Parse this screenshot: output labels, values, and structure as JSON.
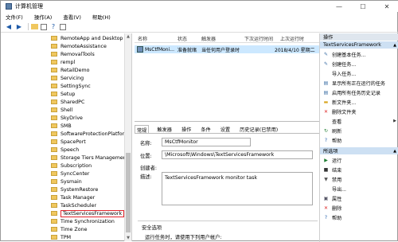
{
  "window": {
    "title": "计算机管理",
    "controls": [
      "—",
      "☐",
      "✕"
    ]
  },
  "menu": [
    "文件(F)",
    "操作(A)",
    "查看(V)",
    "帮助(H)"
  ],
  "tree": {
    "items": [
      "RemoteApp and Desktop C",
      "RemoteAssistance",
      "RemovalTools",
      "rempl",
      "RetailDemo",
      "Servicing",
      "SettingSync",
      "Setup",
      "SharedPC",
      "Shell",
      "SkyDrive",
      "SMB",
      "SoftwareProtectionPlatform",
      "SpacePort",
      "Speech",
      "Storage Tiers Management",
      "Subscription",
      "SyncCenter",
      "Sysmain",
      "SystemRestore",
      "Task Manager",
      "TaskScheduler",
      "TextServicesFramework",
      "Time Synchronization",
      "Time Zone",
      "TPM"
    ],
    "selected_index": 22
  },
  "list": {
    "headers": [
      "名称",
      "状态",
      "触发器",
      "下次运行时间",
      "上次运行时"
    ],
    "row": {
      "name": "MsCtfMoni...",
      "status": "准备就绪",
      "trigger": "当任何用户登录时",
      "next": "",
      "last": "2018/4/10 星期二"
    }
  },
  "detail": {
    "tabs": [
      "常规",
      "触发器",
      "操作",
      "条件",
      "设置",
      "历史记录(已禁用)"
    ],
    "name_label": "名称:",
    "name_value": "MsCtfMonitor",
    "location_label": "位置:",
    "location_value": "\\Microsoft\\Windows\\TextServicesFramework",
    "author_label": "创建者:",
    "desc_label": "描述:",
    "desc_value": "TextServicesFramework monitor task",
    "security_title": "安全选项",
    "security_text": "运行任务时，请使用下列用户帐户:"
  },
  "actions": {
    "header": "操作",
    "group1": "TextServicesFramework",
    "items1": [
      {
        "icon": "create-basic-task-icon",
        "label": "创建基本任务..."
      },
      {
        "icon": "create-task-icon",
        "label": "创建任务..."
      },
      {
        "icon": "",
        "label": "导入任务..."
      },
      {
        "icon": "display-running-icon",
        "label": "显示所有正在运行的任务"
      },
      {
        "icon": "enable-history-icon",
        "label": "启用所有任务历史记录"
      },
      {
        "icon": "new-folder-icon",
        "label": "新文件夹..."
      },
      {
        "icon": "delete-icon",
        "label": "删除文件夹"
      },
      {
        "icon": "",
        "label": "查看"
      },
      {
        "icon": "refresh-icon",
        "label": "刷新"
      },
      {
        "icon": "help-icon",
        "label": "帮助"
      }
    ],
    "group2": "所选项",
    "items2": [
      {
        "icon": "run-icon",
        "label": "运行"
      },
      {
        "icon": "end-icon",
        "label": "结束"
      },
      {
        "icon": "disable-icon",
        "label": "禁用"
      },
      {
        "icon": "",
        "label": "导出..."
      },
      {
        "icon": "properties-icon",
        "label": "属性"
      },
      {
        "icon": "delete-icon",
        "label": "删除"
      },
      {
        "icon": "help-icon",
        "label": "帮助"
      }
    ]
  }
}
